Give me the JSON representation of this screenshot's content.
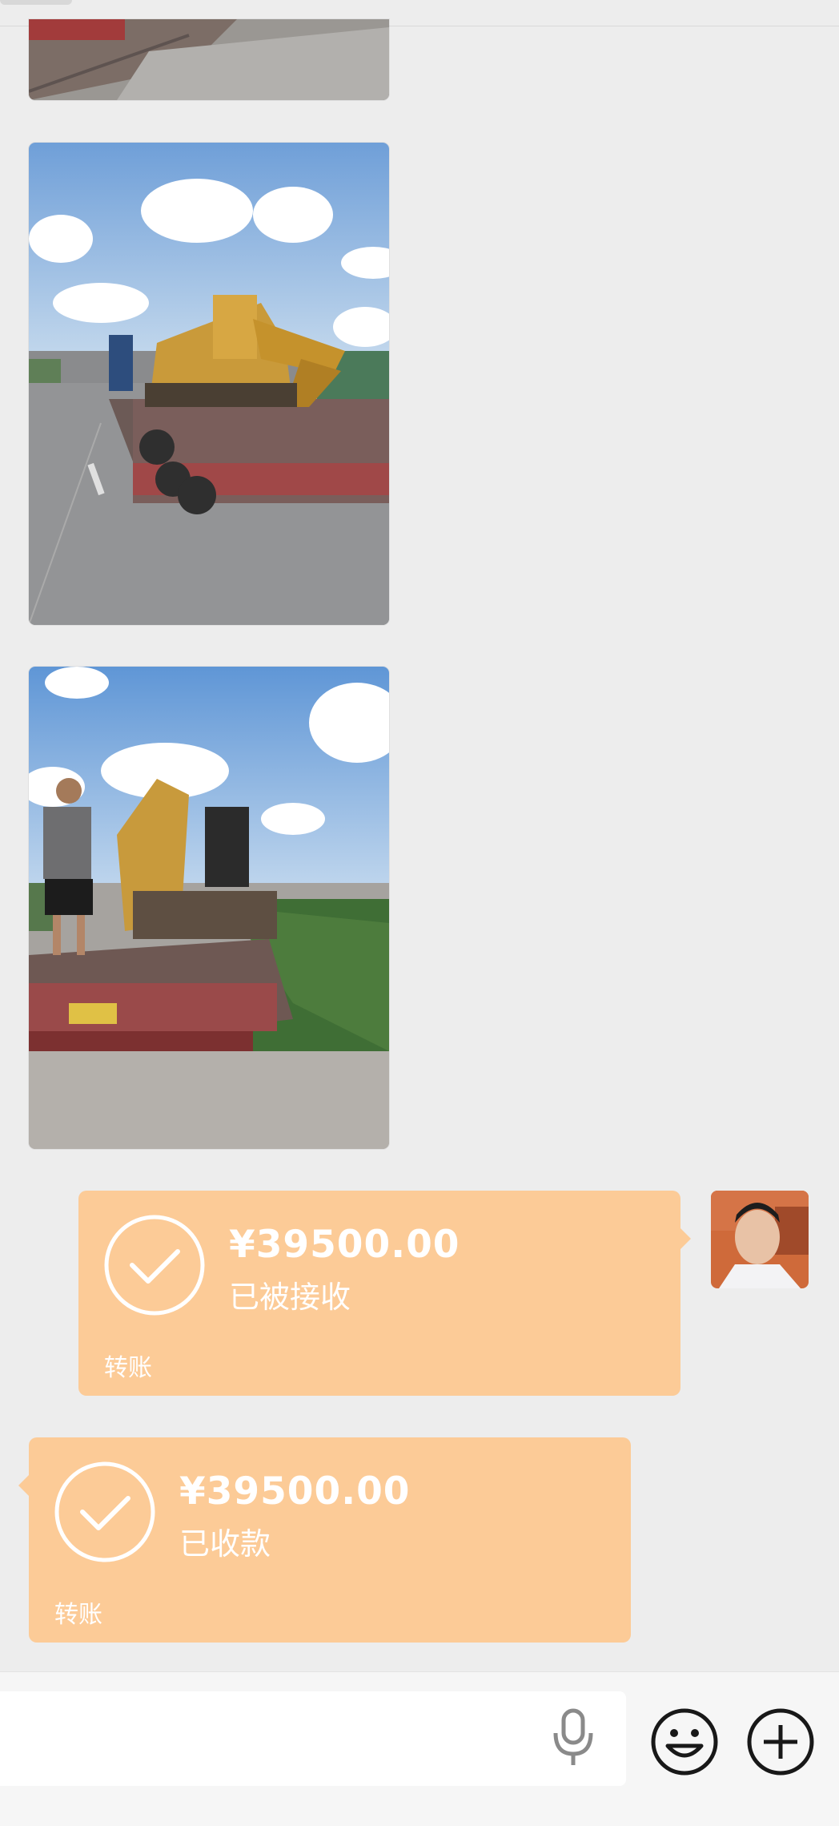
{
  "transfers": [
    {
      "direction": "sent",
      "amount": "¥39500.00",
      "status": "已被接收",
      "label": "转账"
    },
    {
      "direction": "received",
      "amount": "¥39500.00",
      "status": "已收款",
      "label": "转账"
    }
  ],
  "images": [
    {
      "description_icon": "truck-excavator-photo-partial"
    },
    {
      "description_icon": "truck-excavator-photo"
    },
    {
      "description_icon": "truck-excavator-rear-photo"
    }
  ],
  "colors": {
    "background": "#ededed",
    "transfer_bubble": "#fccb97",
    "input_bar": "#f6f6f6"
  },
  "icons": {
    "mic": "microphone-icon",
    "emoji": "smiley-icon",
    "plus": "plus-icon"
  }
}
